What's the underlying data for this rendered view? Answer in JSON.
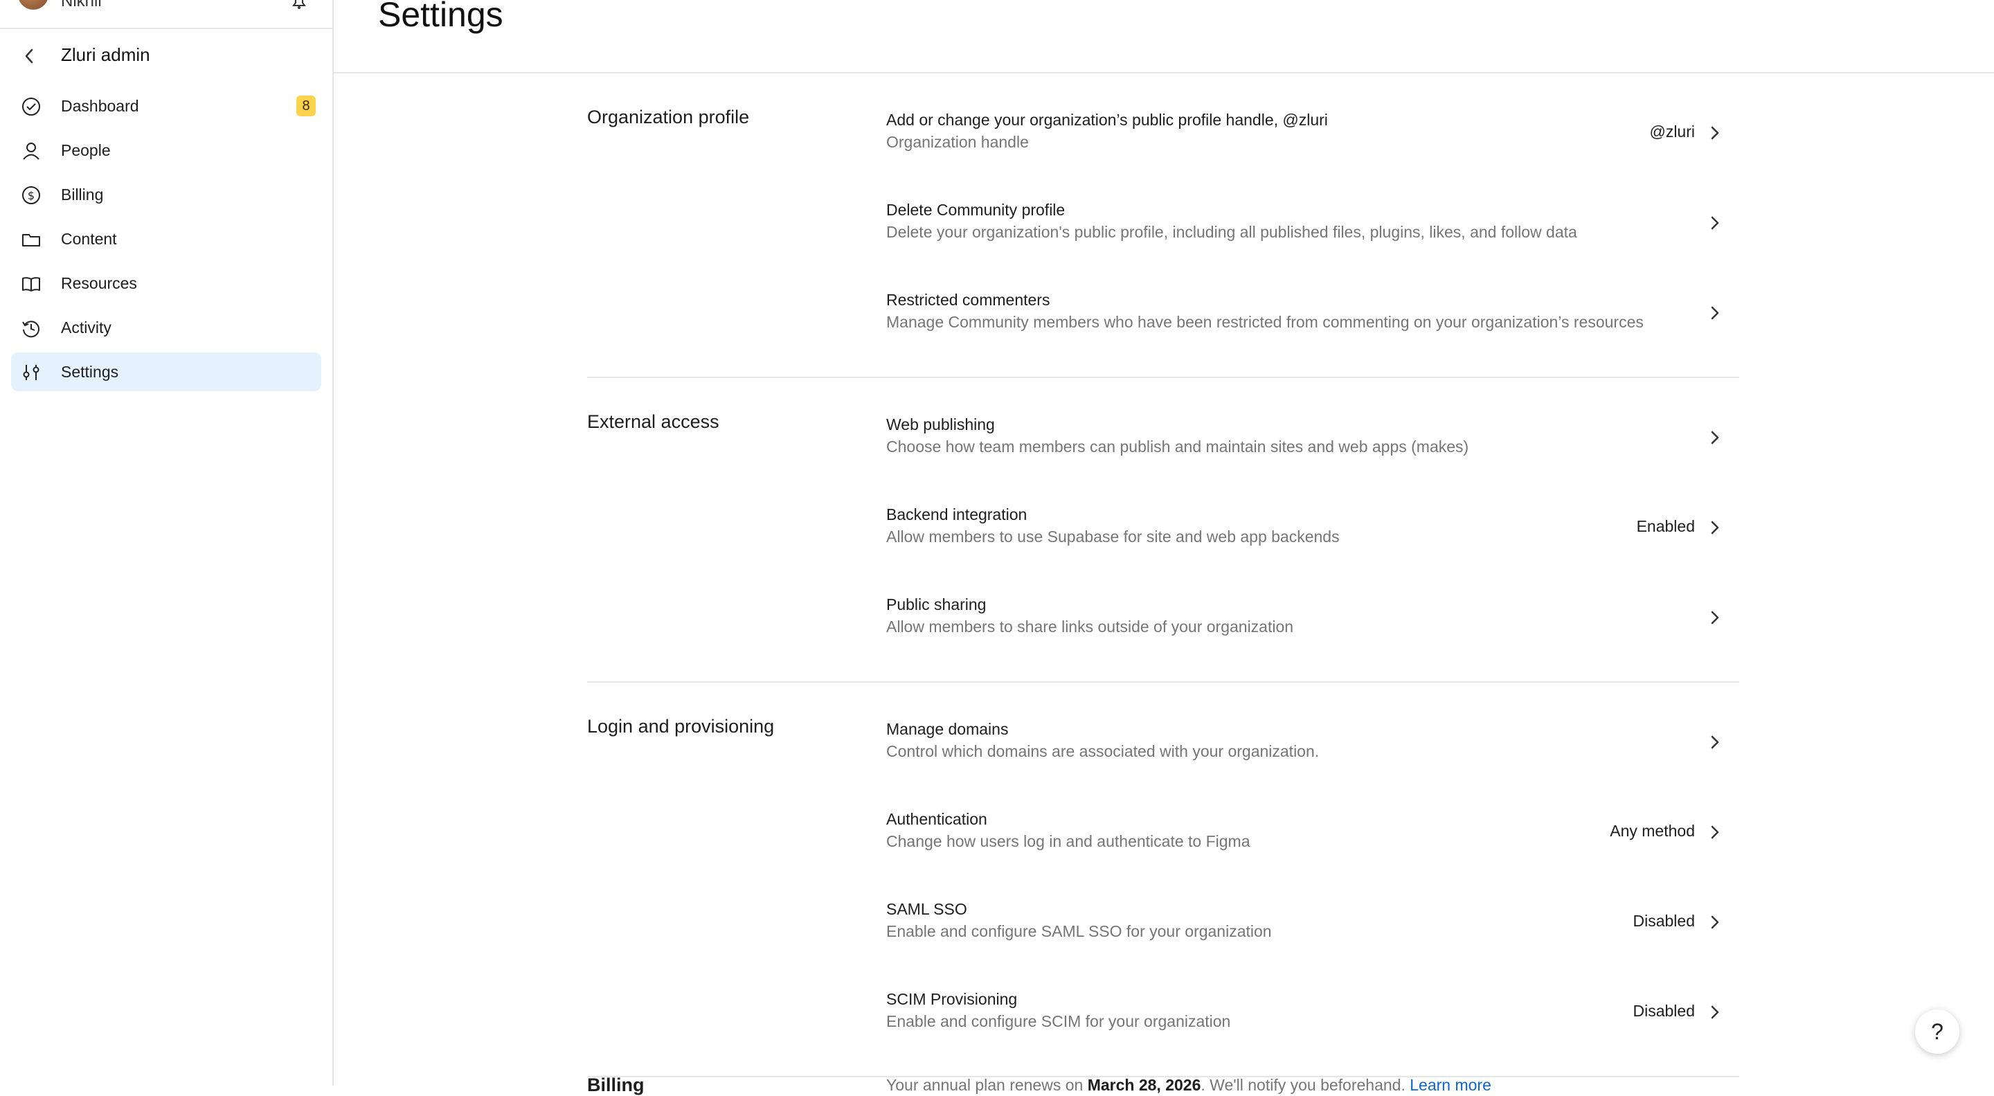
{
  "sidebar": {
    "username": "Nikhil",
    "title": "Zluri admin",
    "items": [
      {
        "label": "Dashboard",
        "icon": "check-circle-icon",
        "badge": "8"
      },
      {
        "label": "People",
        "icon": "person-icon"
      },
      {
        "label": "Billing",
        "icon": "dollar-circle-icon"
      },
      {
        "label": "Content",
        "icon": "folder-icon"
      },
      {
        "label": "Resources",
        "icon": "book-icon"
      },
      {
        "label": "Activity",
        "icon": "history-icon"
      },
      {
        "label": "Settings",
        "icon": "sliders-icon",
        "active": true
      }
    ]
  },
  "header": {
    "title": "Settings"
  },
  "sections": [
    {
      "title": "Organization profile",
      "rows": [
        {
          "title": "Add or change your organization’s public profile handle, @zluri",
          "desc": "Organization handle",
          "value": "@zluri"
        },
        {
          "title": "Delete Community profile",
          "desc": "Delete your organization's public profile, including all published files, plugins, likes, and follow data",
          "value": ""
        },
        {
          "title": "Restricted commenters",
          "desc": "Manage Community members who have been restricted from commenting on your organization’s resources",
          "value": ""
        }
      ]
    },
    {
      "title": "External access",
      "rows": [
        {
          "title": "Web publishing",
          "desc": "Choose how team members can publish and maintain sites and web apps (makes)",
          "value": ""
        },
        {
          "title": "Backend integration",
          "desc": "Allow members to use Supabase for site and web app backends",
          "value": "Enabled"
        },
        {
          "title": "Public sharing",
          "desc": "Allow members to share links outside of your organization",
          "value": ""
        }
      ]
    },
    {
      "title": "Login and provisioning",
      "rows": [
        {
          "title": "Manage domains",
          "desc": "Control which domains are associated with your organization.",
          "value": ""
        },
        {
          "title": "Authentication",
          "desc": "Change how users log in and authenticate to Figma",
          "value": "Any method"
        },
        {
          "title": "SAML SSO",
          "desc": "Enable and configure SAML SSO for your organization",
          "value": "Disabled"
        },
        {
          "title": "SCIM Provisioning",
          "desc": "Enable and configure SCIM for your organization",
          "value": "Disabled"
        }
      ]
    }
  ],
  "billing": {
    "title": "Billing",
    "text_before": "Your annual plan renews on ",
    "date": "March 28, 2026",
    "text_after": ". We'll notify you beforehand. ",
    "link": "Learn more"
  },
  "help": {
    "label": "?"
  },
  "colors": {
    "accent": "#0d66d0",
    "active_bg": "#e5f2fd",
    "badge": "#fcd34d"
  }
}
